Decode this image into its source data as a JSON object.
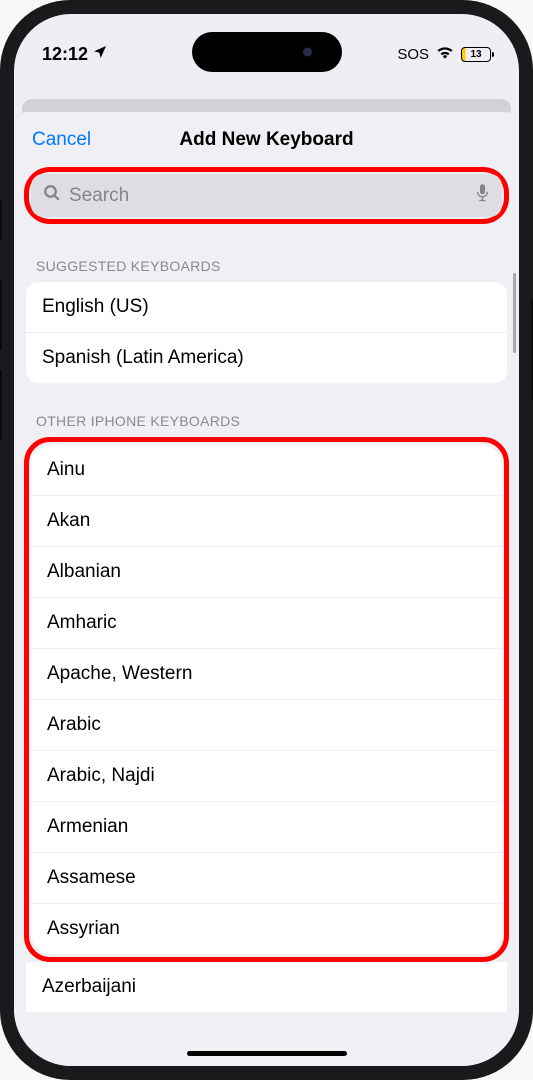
{
  "status": {
    "time": "12:12",
    "sos": "SOS",
    "battery": "13"
  },
  "modal": {
    "cancel": "Cancel",
    "title": "Add New Keyboard"
  },
  "search": {
    "placeholder": "Search"
  },
  "sections": {
    "suggested_label": "SUGGESTED KEYBOARDS",
    "suggested": [
      "English (US)",
      "Spanish (Latin America)"
    ],
    "other_label": "OTHER IPHONE KEYBOARDS",
    "other": [
      "Ainu",
      "Akan",
      "Albanian",
      "Amharic",
      "Apache, Western",
      "Arabic",
      "Arabic, Najdi",
      "Armenian",
      "Assamese",
      "Assyrian"
    ],
    "overflow": "Azerbaijani"
  }
}
